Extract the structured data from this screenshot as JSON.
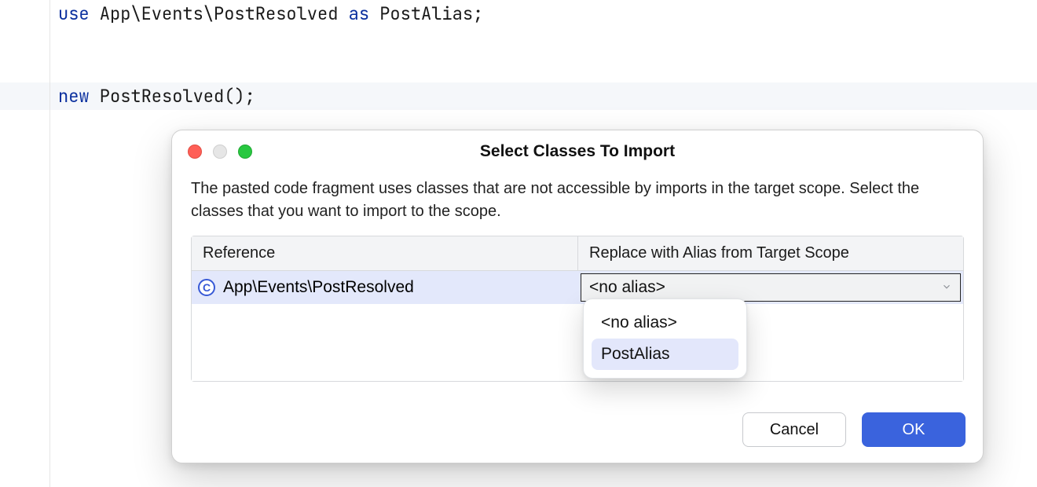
{
  "code": {
    "line1": {
      "kw": "use",
      "rest": " App\\Events\\PostResolved ",
      "as": "as",
      "alias": " PostAlias",
      "semi": ";"
    },
    "line3": {
      "kw": "new",
      "rest": " PostResolved();"
    }
  },
  "dialog": {
    "title": "Select Classes To Import",
    "description": "The pasted code fragment uses classes that are not accessible by imports in the target scope. Select the classes that you want to import to the scope.",
    "columns": {
      "reference": "Reference",
      "alias": "Replace with Alias from Target Scope"
    },
    "row": {
      "icon_letter": "C",
      "reference": "App\\Events\\PostResolved",
      "selected_alias": "<no alias>"
    },
    "dropdown": {
      "options": [
        "<no alias>",
        "PostAlias"
      ],
      "highlighted_index": 1
    },
    "buttons": {
      "cancel": "Cancel",
      "ok": "OK"
    }
  }
}
